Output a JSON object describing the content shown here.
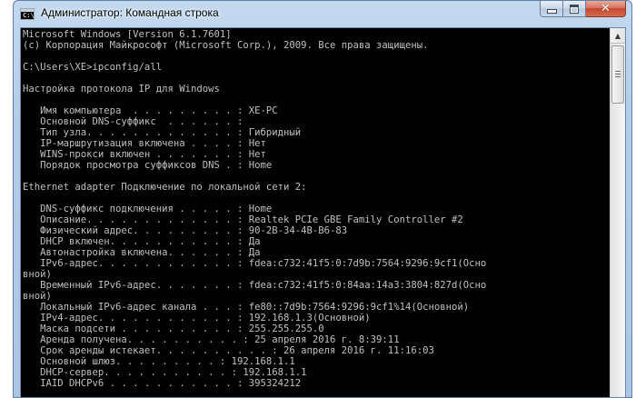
{
  "window": {
    "title": "Администратор: Командная строка",
    "icon_text": "C:\\"
  },
  "caption_buttons": {
    "minimize_icon": "minimize-icon",
    "maximize_icon": "maximize-icon",
    "close_glyph": "✕"
  },
  "console": {
    "lines": [
      "Microsoft Windows [Version 6.1.7601]",
      "(c) Корпорация Майкрософт (Microsoft Corp.), 2009. Все права защищены.",
      "",
      "C:\\Users\\XE>ipconfig/all",
      "",
      "Настройка протокола IP для Windows",
      "",
      "   Имя компьютера  . . . . . . . . . : XE-PC",
      "   Основной DNS-суффикс  . . . . . . :",
      "   Тип узла. . . . . . . . . . . . . : Гибридный",
      "   IP-маршрутизация включена . . . . : Нет",
      "   WINS-прокси включен . . . . . . . : Нет",
      "   Порядок просмотра суффиксов DNS . : Home",
      "",
      "Ethernet adapter Подключение по локальной сети 2:",
      "",
      "   DNS-суффикс подключения . . . . . : Home",
      "   Описание. . . . . . . . . . . . . : Realtek PCIe GBE Family Controller #2",
      "   Физический адрес. . . . . . . . . : 90-2B-34-4B-B6-83",
      "   DHCP включен. . . . . . . . . . . : Да",
      "   Автонастройка включена. . . . . . : Да",
      "   IPv6-адрес. . . . . . . . . . . . : fdea:c732:41f5:0:7d9b:7564:9296:9cf1(Осно",
      "вной)",
      "   Временный IPv6-адрес. . . . . . . : fdea:c732:41f5:0:84aa:14a3:3804:827d(Осно",
      "вной)",
      "   Локальный IPv6-адрес канала . . . : fe80::7d9b:7564:9296:9cf1%14(Основной)",
      "   IPv4-адрес. . . . . . . . . . . . : 192.168.1.3(Основной)",
      "   Маска подсети . . . . . . . . . . : 255.255.255.0",
      "   Аренда получена. . . . . . . . . . : 25 апреля 2016 г. 8:39:11",
      "   Срок аренды истекает. . . . . . . . . . : 26 апреля 2016 г. 11:16:03",
      "   Основной шлюз. . . . . . . . . : 192.168.1.1",
      "   DHCP-сервер. . . . . . . . . . . : 192.168.1.1",
      "   IAID DHCPv6 . . . . . . . . . . . : 395324212"
    ]
  },
  "scrollbar": {
    "up_arrow": "▲"
  }
}
